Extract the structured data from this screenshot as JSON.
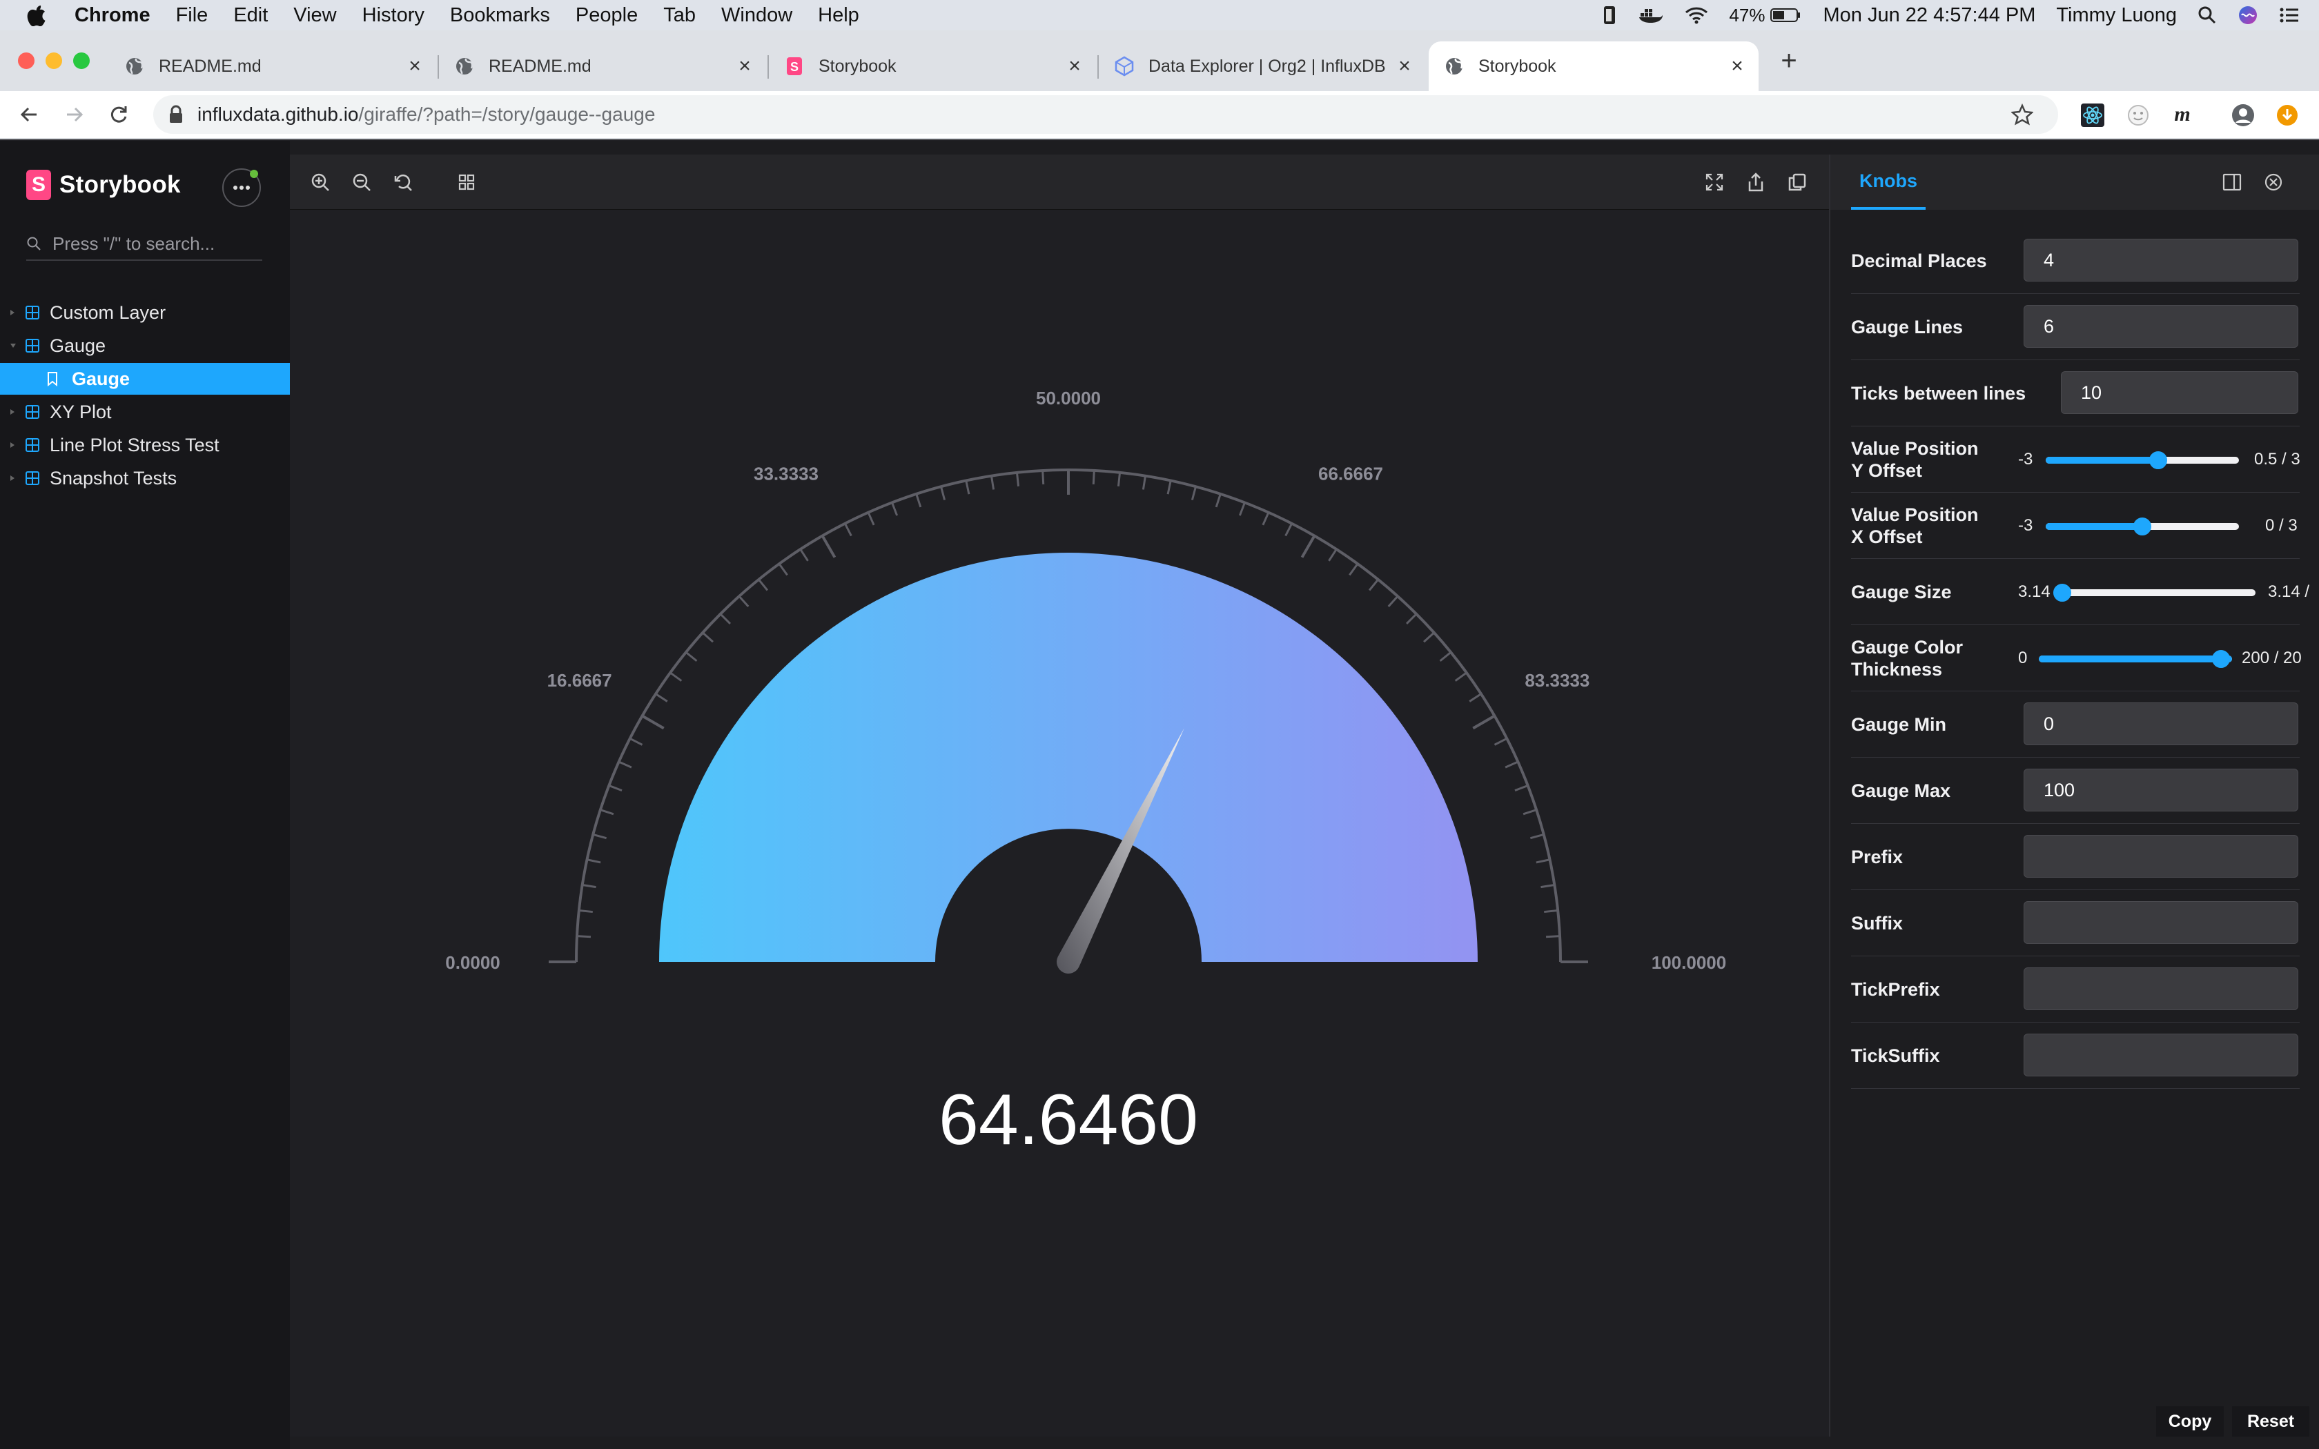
{
  "menubar": {
    "items": [
      "Chrome",
      "File",
      "Edit",
      "View",
      "History",
      "Bookmarks",
      "People",
      "Tab",
      "Window",
      "Help"
    ],
    "battery": "47%",
    "datetime": "Mon Jun 22  4:57:44 PM",
    "user": "Timmy Luong"
  },
  "tabs": [
    {
      "title": "README.md",
      "icon": "globe-icon"
    },
    {
      "title": "README.md",
      "icon": "globe-icon"
    },
    {
      "title": "Storybook",
      "icon": "storybook-icon"
    },
    {
      "title": "Data Explorer | Org2 | InfluxDB",
      "icon": "influxdb-icon"
    },
    {
      "title": "Storybook",
      "icon": "globe-icon"
    }
  ],
  "address": {
    "host": "influxdata.github.io",
    "path": "/giraffe/?path=/story/gauge--gauge"
  },
  "sidebar": {
    "brand": "Storybook",
    "search_placeholder": "Press \"/\" to search...",
    "items": [
      {
        "label": "Custom Layer",
        "level": 0
      },
      {
        "label": "Gauge",
        "level": 0
      },
      {
        "label": "Gauge",
        "level": 1,
        "selected": true
      },
      {
        "label": "XY Plot",
        "level": 0
      },
      {
        "label": "Line Plot Stress Test",
        "level": 0
      },
      {
        "label": "Snapshot Tests",
        "level": 0
      }
    ]
  },
  "gauge": {
    "min": 0,
    "max": 100,
    "value": 64.646,
    "value_label": "64.6460",
    "gauge_lines": 6,
    "ticks_between_lines": 10,
    "tick_labels": [
      "0.0000",
      "16.6667",
      "33.3333",
      "50.0000",
      "66.6667",
      "83.3333",
      "100.0000"
    ],
    "gradient_start": "#4fc6fb",
    "gradient_end": "#9393f2"
  },
  "knobs": {
    "tab_label": "Knobs",
    "decimal_places": {
      "label": "Decimal Places",
      "value": "4"
    },
    "gauge_lines": {
      "label": "Gauge Lines",
      "value": "6"
    },
    "ticks_between": {
      "label": "Ticks between lines",
      "value": "10"
    },
    "value_y": {
      "label_1": "Value Position",
      "label_2": "Y Offset",
      "min": "-3",
      "display": "0.5 / 3",
      "fraction": 0.583
    },
    "value_x": {
      "label_1": "Value Position",
      "label_2": "X Offset",
      "min": "-3",
      "display": "0 / 3",
      "fraction": 0.5
    },
    "gauge_size": {
      "label": "Gauge Size",
      "min": "3.14",
      "display": "3.14 /",
      "fraction": 0.0
    },
    "gauge_color": {
      "label_1": "Gauge Color",
      "label_2": "Thickness",
      "min": "0",
      "display": "200 / 20",
      "fraction": 1.0
    },
    "gauge_min": {
      "label": "Gauge Min",
      "value": "0"
    },
    "gauge_max": {
      "label": "Gauge Max",
      "value": "100"
    },
    "prefix": {
      "label": "Prefix",
      "value": ""
    },
    "suffix": {
      "label": "Suffix",
      "value": ""
    },
    "tick_prefix": {
      "label": "TickPrefix",
      "value": ""
    },
    "tick_suffix": {
      "label": "TickSuffix",
      "value": ""
    },
    "copy_label": "Copy",
    "reset_label": "Reset"
  }
}
